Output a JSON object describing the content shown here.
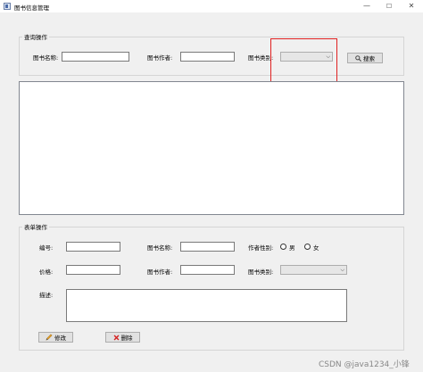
{
  "window": {
    "title": "图书信息管理",
    "min_label": "—",
    "max_label": "☐",
    "close_label": "✕"
  },
  "query": {
    "group_label": "查询操作",
    "book_name_label": "图书名称:",
    "book_name_value": "",
    "author_label": "图书作者:",
    "author_value": "",
    "category_label": "图书类别:",
    "category_value": "",
    "search_label": "搜索",
    "search_icon": "magnifier-icon"
  },
  "form": {
    "group_label": "表单操作",
    "id_label": "编号:",
    "id_value": "",
    "book_name_label": "图书名称:",
    "book_name_value": "",
    "gender_label": "作者性别:",
    "male_label": "男",
    "female_label": "女",
    "price_label": "价格:",
    "price_value": "",
    "author_label": "图书作者:",
    "author_value": "",
    "category_label": "图书类别:",
    "category_value": "",
    "desc_label": "描述:",
    "desc_value": "",
    "modify_label": "修改",
    "delete_label": "删除"
  },
  "colors": {
    "highlight": "#e02020",
    "delete_icon": "#d42020",
    "edit_icon": "#e8a020"
  },
  "watermark": "CSDN @java1234_小锋"
}
